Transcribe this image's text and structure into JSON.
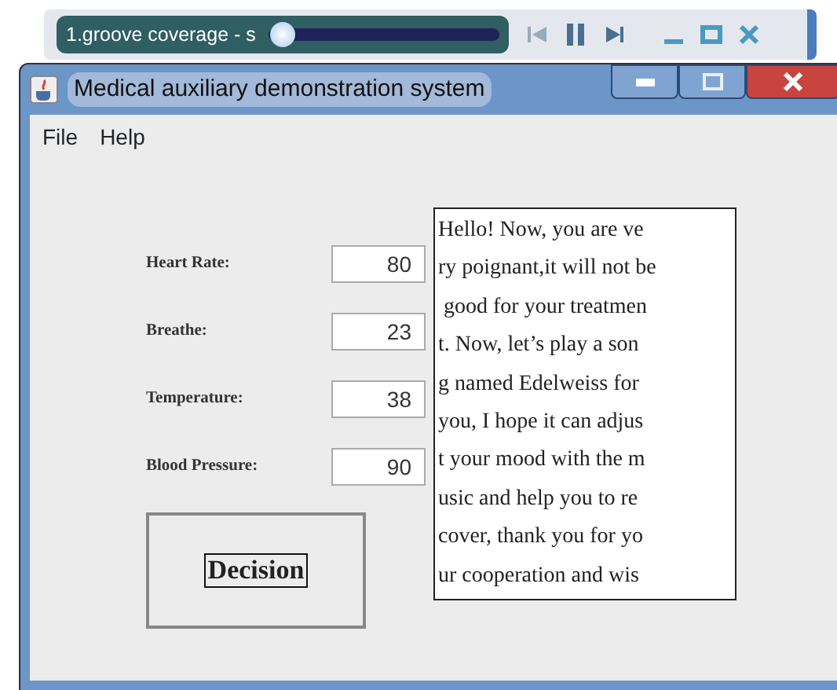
{
  "player": {
    "track": "1.groove coverage - s",
    "level": 0.06
  },
  "window": {
    "title": "Medical auxiliary demonstration system"
  },
  "menu": [
    "File",
    "Help"
  ],
  "fields": [
    {
      "label": "Heart Rate:",
      "value": "80"
    },
    {
      "label": "Breathe:",
      "value": "23"
    },
    {
      "label": "Temperature:",
      "value": "38"
    },
    {
      "label": "Blood Pressure:",
      "value": "90"
    }
  ],
  "decision_button": "Decision",
  "message_lines": [
    "Hello! Now, you are ve",
    "ry poignant,it will not be",
    " good for your treatmen",
    "t. Now, let’s play a son",
    "g named Edelweiss for",
    "you, I hope it can adjus",
    "t your mood with the m",
    "usic and help you to re",
    "cover, thank you for yo",
    "ur cooperation and wis"
  ]
}
